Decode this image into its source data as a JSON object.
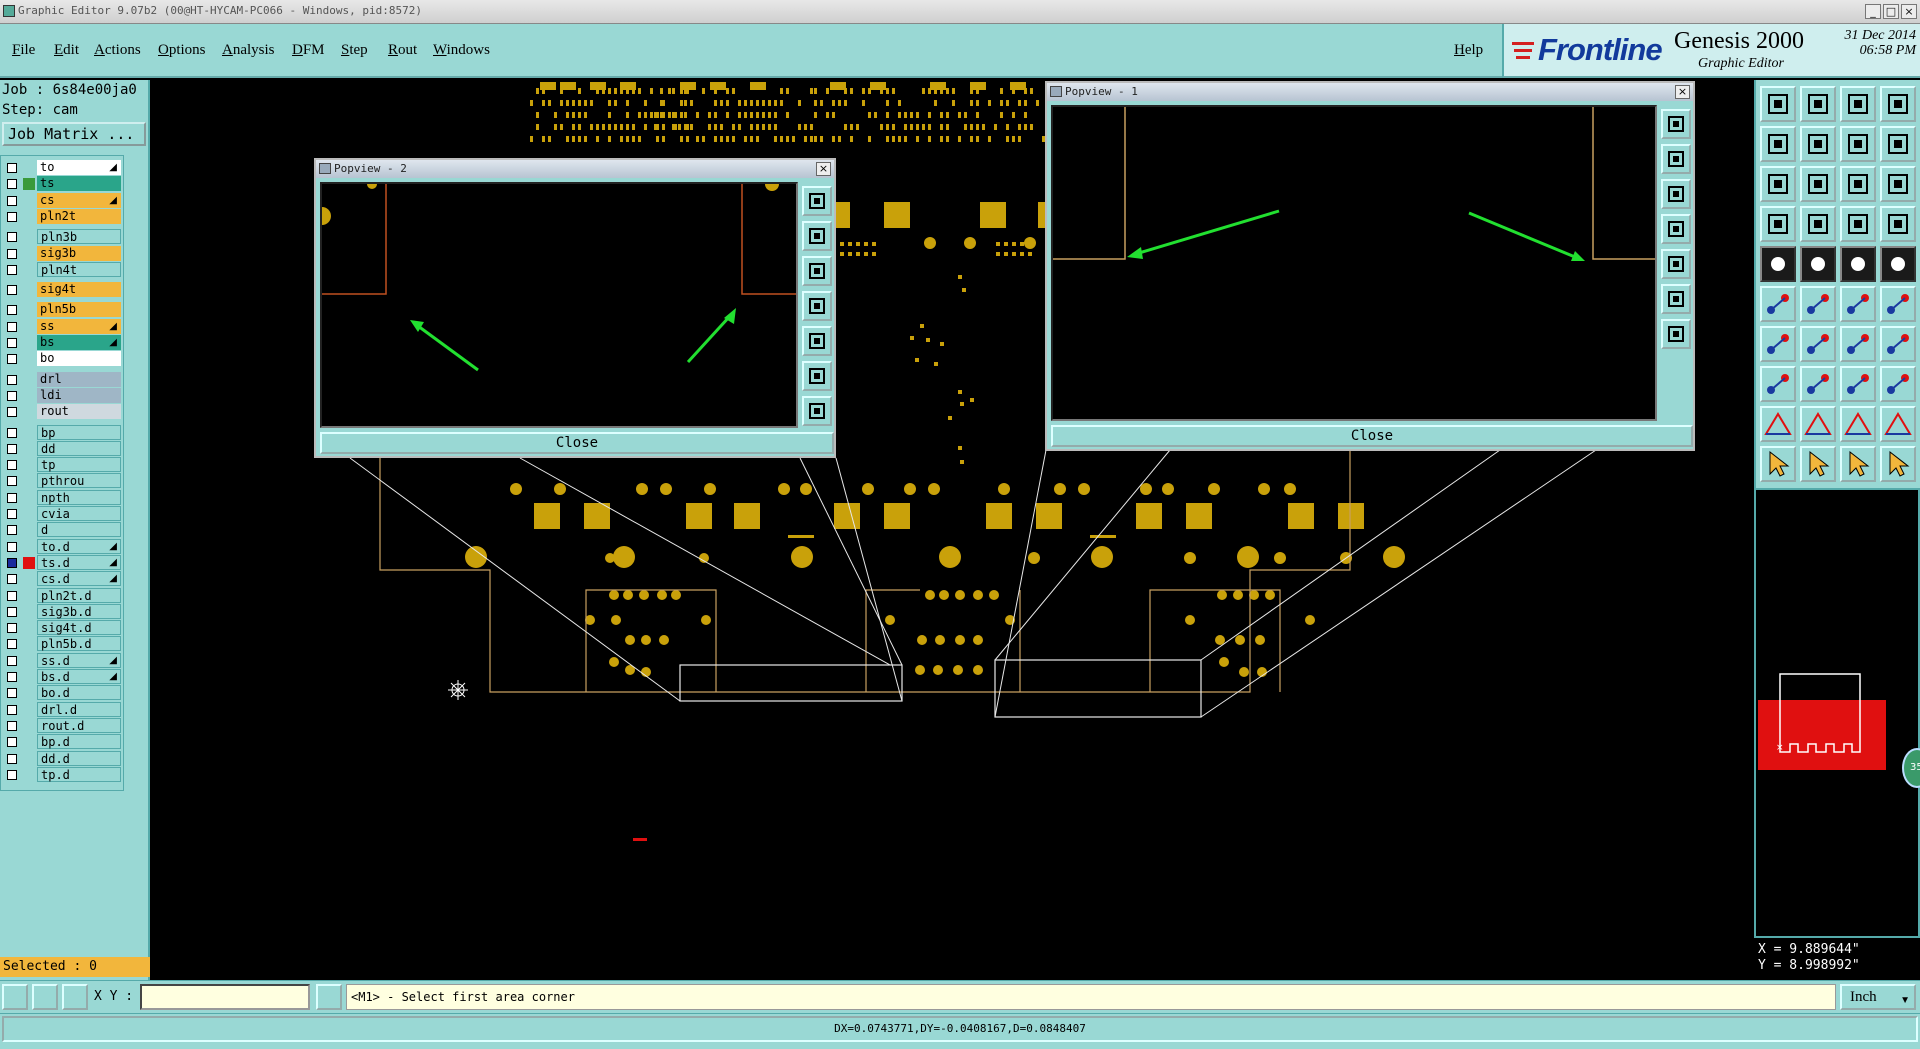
{
  "window": {
    "title": "Graphic Editor 9.07b2 (00@HT-HYCAM-PC066 - Windows, pid:8572)",
    "controls": [
      "_",
      "□",
      "×"
    ]
  },
  "menu": {
    "items": [
      "File",
      "Edit",
      "Actions",
      "Options",
      "Analysis",
      "DFM",
      "Step",
      "Rout",
      "Windows"
    ],
    "help": "Help"
  },
  "brand": {
    "logo": "Frontline",
    "product": "Genesis 2000",
    "subtitle": "Graphic Editor",
    "date": "31 Dec 2014",
    "time": "06:58 PM"
  },
  "job": {
    "job_line": "Job : 6s84e00ja0",
    "step_line": "Step: cam",
    "job_matrix_label": "Job Matrix ..."
  },
  "layers": [
    {
      "name": "to",
      "color": "#ffffff",
      "arrow": true
    },
    {
      "name": "ts",
      "color": "#2aa58a",
      "arrow": false,
      "marker": "#3a9a3a"
    },
    {
      "name": "cs",
      "color": "#f2b63c",
      "arrow": true
    },
    {
      "name": "pln2t",
      "color": "#f2b63c",
      "arrow": false
    },
    {
      "name": "pln3b",
      "color": "#99d8d4",
      "arrow": false
    },
    {
      "name": "sig3b",
      "color": "#f2b63c",
      "arrow": false
    },
    {
      "name": "pln4t",
      "color": "#99d8d4",
      "arrow": false
    },
    {
      "name": "sig4t",
      "color": "#f2b63c",
      "arrow": false
    },
    {
      "name": "pln5b",
      "color": "#f2b63c",
      "arrow": false
    },
    {
      "name": "ss",
      "color": "#f2b63c",
      "arrow": true
    },
    {
      "name": "bs",
      "color": "#2aa58a",
      "arrow": true
    },
    {
      "name": "bo",
      "color": "#ffffff",
      "arrow": false
    },
    {
      "name": "drl",
      "color": "#9fb6c6",
      "arrow": false
    },
    {
      "name": "ldi",
      "color": "#9fb6c6",
      "arrow": false
    },
    {
      "name": "rout",
      "color": "#cfd9df",
      "arrow": false
    },
    {
      "name": "bp",
      "color": "#99d8d4",
      "arrow": false
    },
    {
      "name": "dd",
      "color": "#99d8d4",
      "arrow": false
    },
    {
      "name": "tp",
      "color": "#99d8d4",
      "arrow": false
    },
    {
      "name": "pthrou",
      "color": "#99d8d4",
      "arrow": false
    },
    {
      "name": "npth",
      "color": "#99d8d4",
      "arrow": false
    },
    {
      "name": "cvia",
      "color": "#99d8d4",
      "arrow": false
    },
    {
      "name": "d",
      "color": "#99d8d4",
      "arrow": false
    },
    {
      "name": "to.d",
      "color": "#99d8d4",
      "arrow": true
    },
    {
      "name": "ts.d",
      "color": "#99d8d4",
      "arrow": true,
      "marker": "#e01010",
      "selected": true
    },
    {
      "name": "cs.d",
      "color": "#99d8d4",
      "arrow": true
    },
    {
      "name": "pln2t.d",
      "color": "#99d8d4",
      "arrow": false
    },
    {
      "name": "sig3b.d",
      "color": "#99d8d4",
      "arrow": false
    },
    {
      "name": "sig4t.d",
      "color": "#99d8d4",
      "arrow": false
    },
    {
      "name": "pln5b.d",
      "color": "#99d8d4",
      "arrow": false
    },
    {
      "name": "ss.d",
      "color": "#99d8d4",
      "arrow": true
    },
    {
      "name": "bs.d",
      "color": "#99d8d4",
      "arrow": true
    },
    {
      "name": "bo.d",
      "color": "#99d8d4",
      "arrow": false
    },
    {
      "name": "drl.d",
      "color": "#99d8d4",
      "arrow": false
    },
    {
      "name": "rout.d",
      "color": "#99d8d4",
      "arrow": false
    },
    {
      "name": "bp.d",
      "color": "#99d8d4",
      "arrow": false
    },
    {
      "name": "dd.d",
      "color": "#99d8d4",
      "arrow": false
    },
    {
      "name": "tp.d",
      "color": "#99d8d4",
      "arrow": false
    }
  ],
  "selected_label": "Selected : 0",
  "popview2": {
    "title": "Popview - 2",
    "close_label": "Close"
  },
  "popview1": {
    "title": "Popview - 1",
    "close_label": "Close"
  },
  "coords": {
    "x": "X = 9.889644\"",
    "y": "Y = 8.998992\""
  },
  "thumb_badge": "35",
  "bottom": {
    "xy_label": "X Y :",
    "xy_value": "",
    "message": "<M1> - Select first area corner",
    "unit": "Inch"
  },
  "status": {
    "delta": "DX=0.0743771,DY=-0.0408167,D=0.0848407"
  },
  "colors": {
    "panel": "#99d8d4",
    "copper": "#c9a10a",
    "outline": "#c8a060",
    "profile": "#e8e8e8",
    "arrow": "#22e030",
    "selection": "#e01010"
  }
}
